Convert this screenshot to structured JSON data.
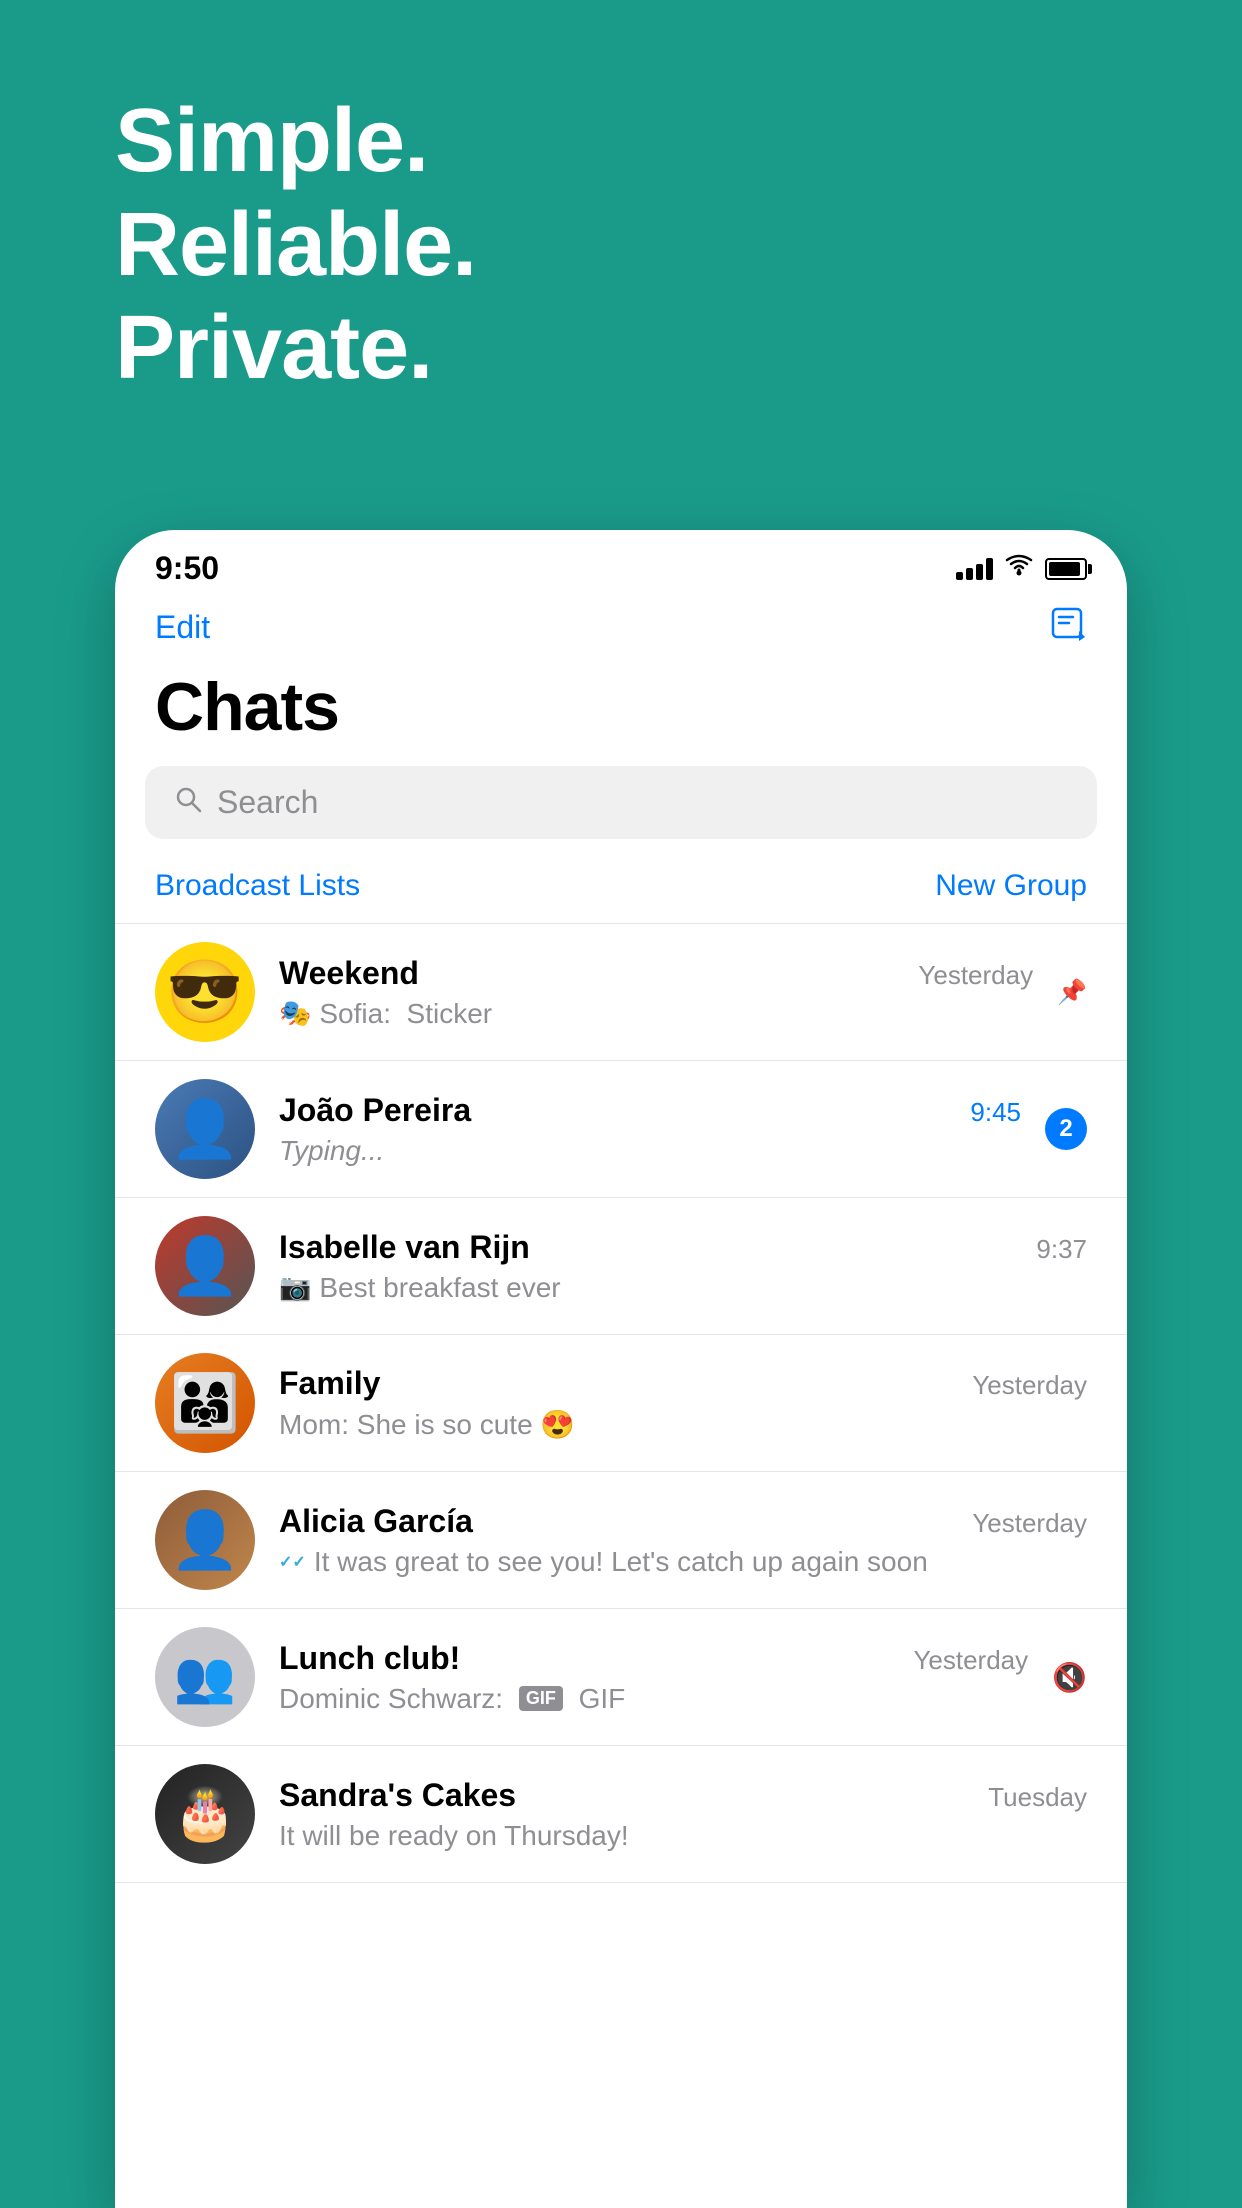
{
  "background": {
    "color": "#1a9b8a"
  },
  "tagline": {
    "line1": "Simple.",
    "line2": "Reliable.",
    "line3": "Private."
  },
  "status_bar": {
    "time": "9:50",
    "signal_bars": 4,
    "wifi": true,
    "battery_percent": 90
  },
  "nav": {
    "edit_label": "Edit",
    "compose_label": "Compose"
  },
  "header": {
    "title": "Chats"
  },
  "search": {
    "placeholder": "Search"
  },
  "actions": {
    "broadcast_label": "Broadcast Lists",
    "new_group_label": "New Group"
  },
  "chats": [
    {
      "id": "weekend",
      "name": "Weekend",
      "preview": "Sofia: 🎭 Sticker",
      "time": "Yesterday",
      "pinned": true,
      "unread": 0,
      "muted": false,
      "avatar_type": "emoji",
      "avatar_emoji": "😎",
      "avatar_bg": "#FFD60A"
    },
    {
      "id": "joao",
      "name": "João Pereira",
      "preview": "Typing...",
      "preview_italic": true,
      "time": "9:45",
      "time_blue": true,
      "pinned": false,
      "unread": 2,
      "muted": false,
      "avatar_type": "person",
      "avatar_bg": "#4a7ab5"
    },
    {
      "id": "isabelle",
      "name": "Isabelle van Rijn",
      "preview": "📷 Best breakfast ever",
      "time": "9:37",
      "pinned": false,
      "unread": 0,
      "muted": false,
      "avatar_type": "person",
      "avatar_bg": "#c0392b"
    },
    {
      "id": "family",
      "name": "Family",
      "preview": "Mom: She is so cute 😍",
      "time": "Yesterday",
      "pinned": false,
      "unread": 0,
      "muted": false,
      "avatar_type": "group_photo",
      "avatar_bg": "#e67e22"
    },
    {
      "id": "alicia",
      "name": "Alicia García",
      "preview": "✓✓ It was great to see you! Let's catch up again soon",
      "time": "Yesterday",
      "pinned": false,
      "unread": 0,
      "muted": false,
      "avatar_type": "person",
      "avatar_bg": "#8e5c3a"
    },
    {
      "id": "lunch",
      "name": "Lunch club!",
      "preview": "Dominic Schwarz: GIF GIF",
      "time": "Yesterday",
      "pinned": false,
      "unread": 0,
      "muted": true,
      "avatar_type": "group",
      "avatar_bg": "#c7c7cc"
    },
    {
      "id": "sandra",
      "name": "Sandra's Cakes",
      "preview": "It will be ready on Thursday!",
      "time": "Tuesday",
      "pinned": false,
      "unread": 0,
      "muted": false,
      "avatar_type": "photo",
      "avatar_bg": "#222"
    }
  ]
}
